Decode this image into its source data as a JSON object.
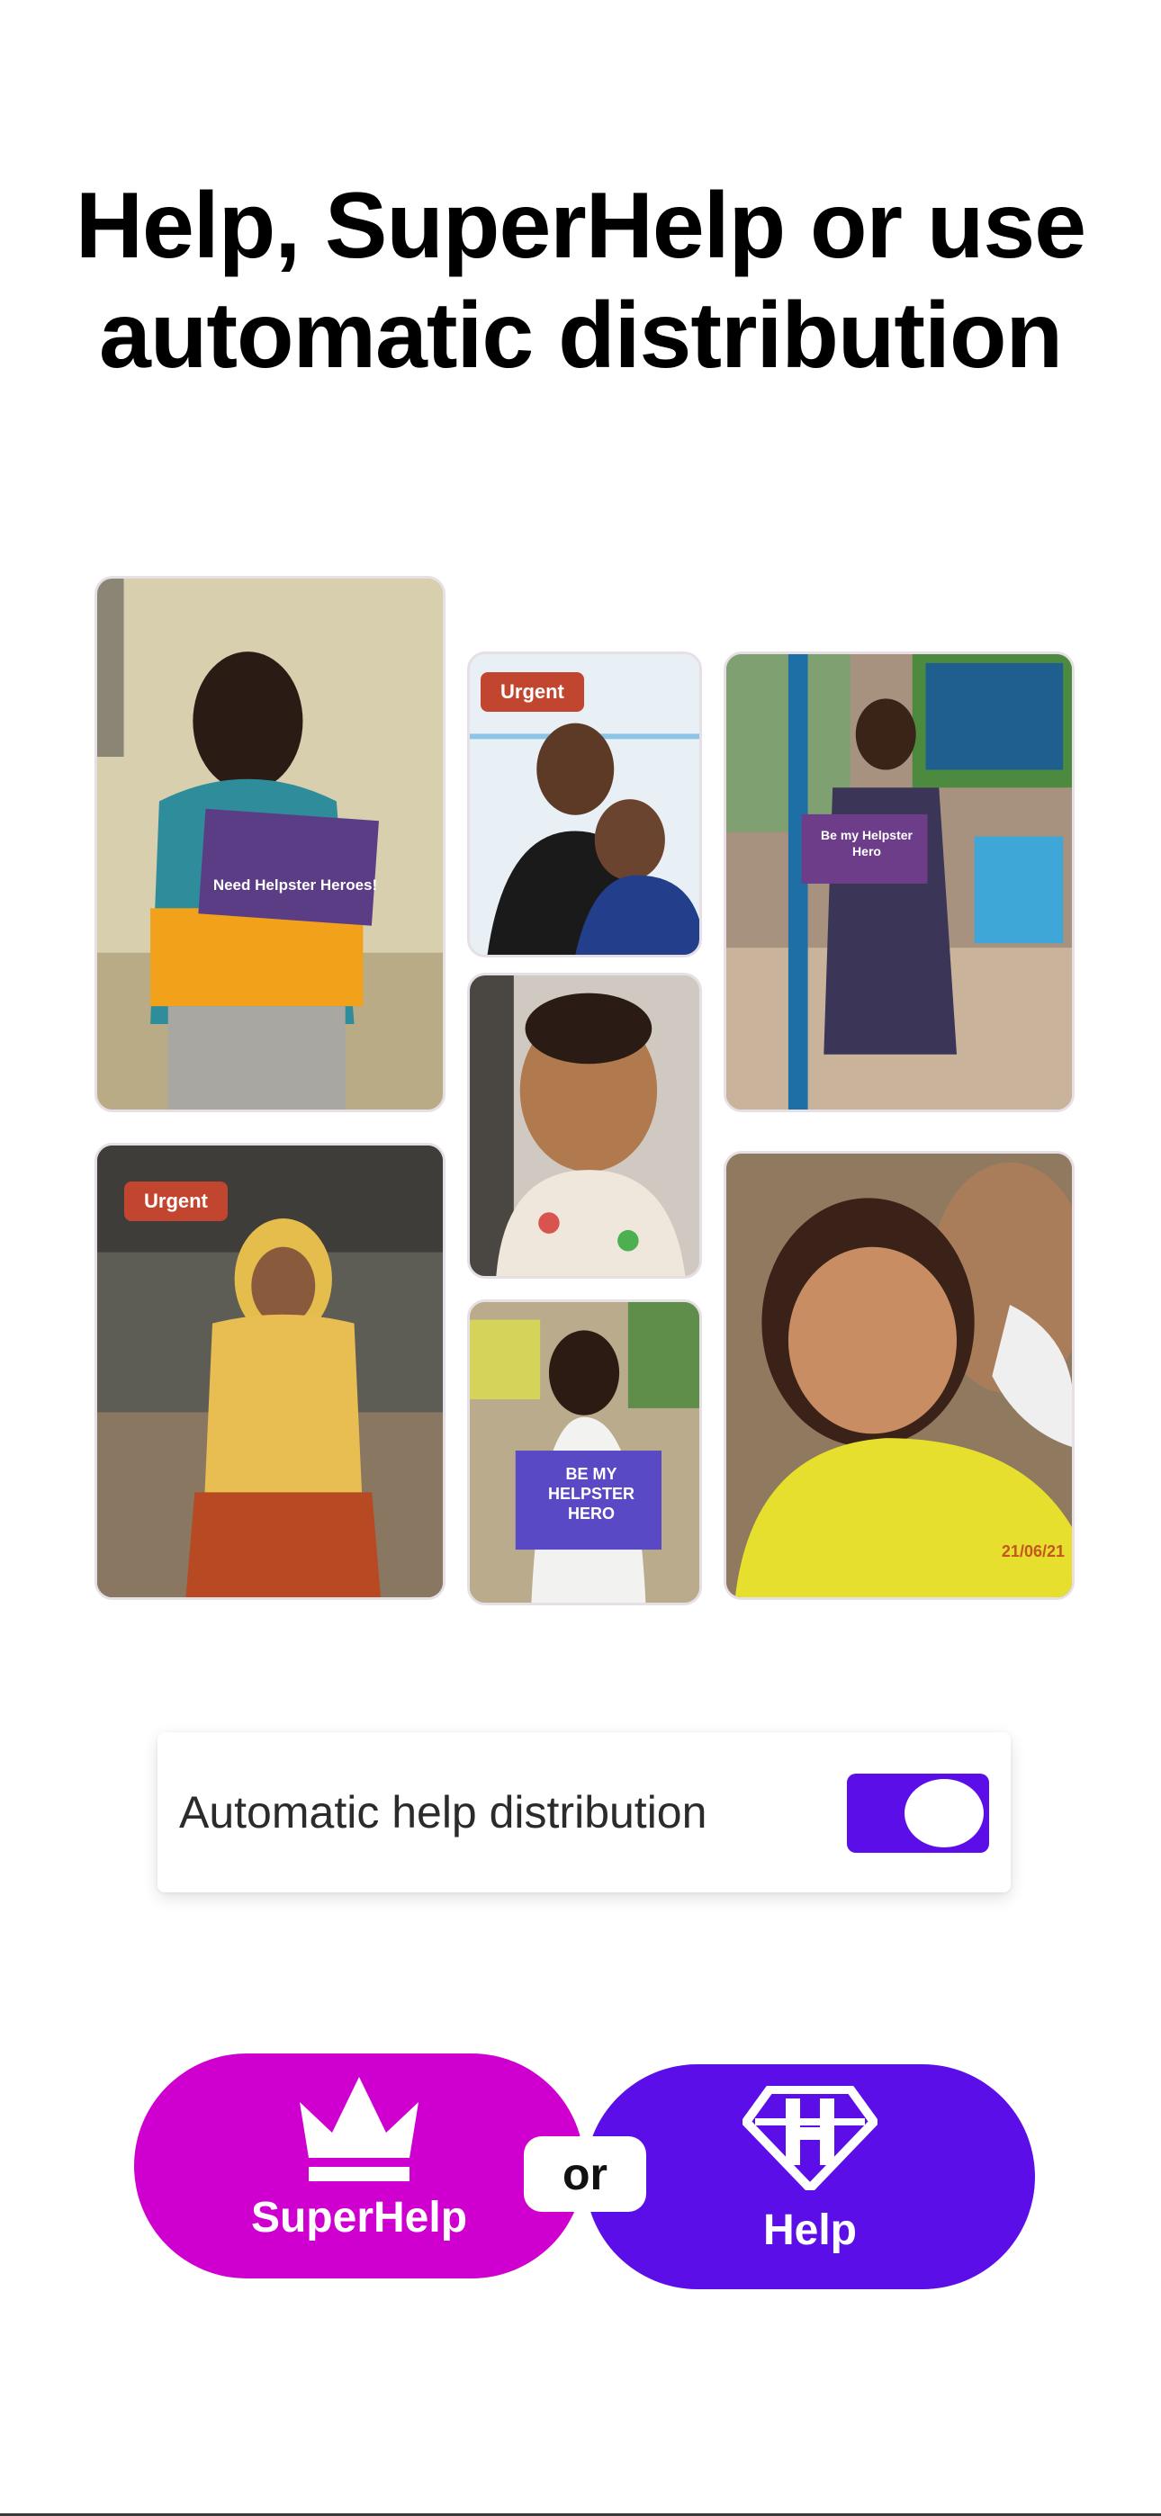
{
  "header": {
    "title_line1": "Help, SuperHelp or use",
    "title_line2": "automatic distribution"
  },
  "gallery": {
    "tiles": [
      {
        "sign": "Need Helpster Heroes!",
        "badge": ""
      },
      {
        "sign": "",
        "badge": "Urgent"
      },
      {
        "sign": "Be my Helpster Hero",
        "badge": ""
      },
      {
        "sign": "",
        "badge": ""
      },
      {
        "sign": "",
        "badge": "Urgent"
      },
      {
        "sign": "BE MY HELPSTER HERO",
        "badge": ""
      },
      {
        "sign": "21/06/21",
        "badge": ""
      }
    ]
  },
  "toggle": {
    "label": "Automatic help distribution",
    "enabled": true,
    "color": "#5b0ee8"
  },
  "actions": {
    "superhelp_label": "SuperHelp",
    "superhelp_icon": "crown-icon",
    "superhelp_color": "#cf00cf",
    "or_label": "or",
    "help_label": "Help",
    "help_icon": "shield-h-icon",
    "help_color": "#5b0ee8"
  }
}
